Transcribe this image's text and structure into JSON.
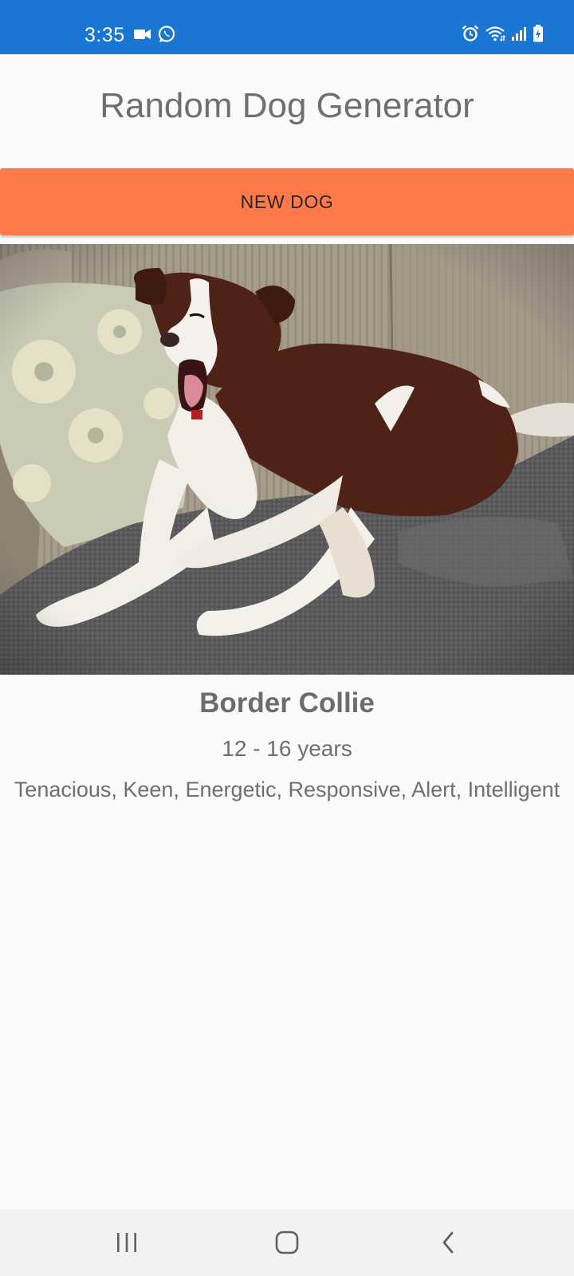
{
  "status_bar": {
    "time": "3:35",
    "left_icons": [
      "video-camera-icon",
      "whatsapp-icon"
    ],
    "right_icons": [
      "alarm-icon",
      "wifi-icon",
      "signal-icon",
      "battery-charging-icon"
    ],
    "background": "#1976d2"
  },
  "app": {
    "title": "Random Dog Generator"
  },
  "button": {
    "label": "NEW DOG",
    "color": "#ff7a4b"
  },
  "dog": {
    "breed": "Border Collie",
    "life_span": "12 - 16 years",
    "temperament": "Tenacious, Keen, Energetic, Responsive, Alert, Intelligent"
  },
  "nav_bar": {
    "buttons": [
      "recent-apps-icon",
      "home-icon",
      "back-icon"
    ]
  }
}
